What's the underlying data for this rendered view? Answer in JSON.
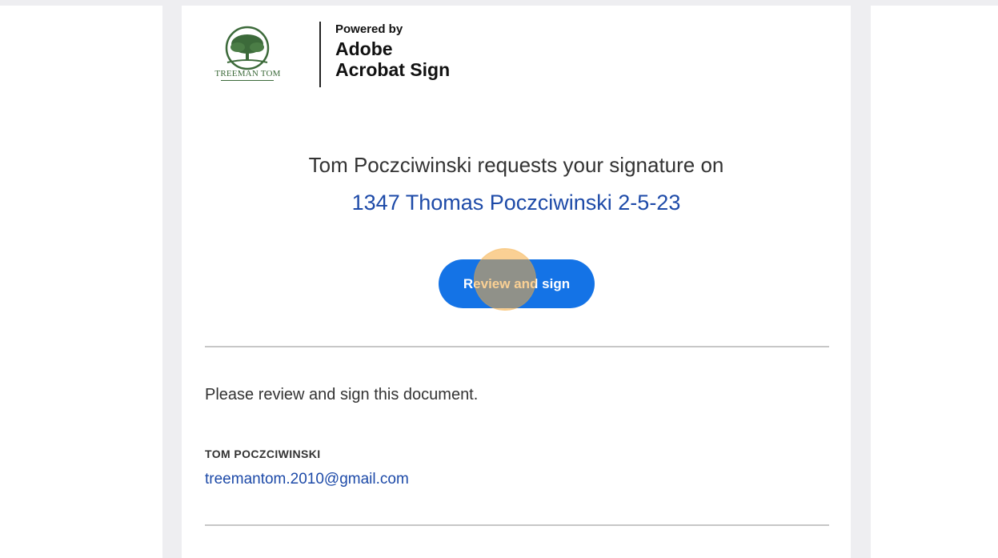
{
  "brand": {
    "company_logo_text": "TREEMAN TOM",
    "powered_by_label": "Powered by",
    "product_line1": "Adobe",
    "product_line2": "Acrobat Sign"
  },
  "email": {
    "request_text": "Tom Poczciwinski requests your signature on",
    "document_title": "1347 Thomas Poczciwinski 2-5-23",
    "review_button_label": "Review and sign",
    "message": "Please review and sign this document.",
    "sender_name": "TOM POCZCIWINSKI",
    "sender_email": "treemantom.2010@gmail.com"
  },
  "colors": {
    "accent": "#1473e6",
    "link": "#1d4aa8",
    "page_bg": "#eeeef1",
    "logo_green": "#3c6a3a"
  }
}
